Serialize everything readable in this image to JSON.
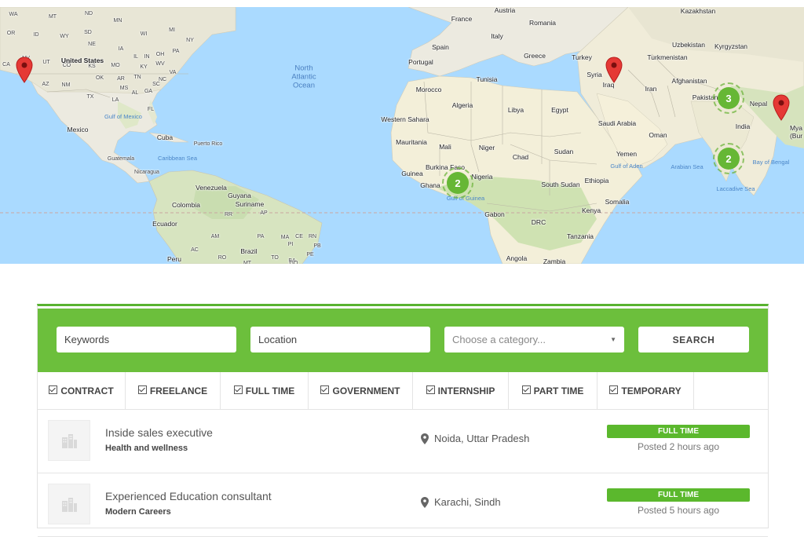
{
  "map": {
    "ocean_labels": [
      {
        "text": "North\nAtlantic\nOcean"
      }
    ],
    "land_labels": [
      "WA",
      "MT",
      "ND",
      "MN",
      "WI",
      "MI",
      "OR",
      "ID",
      "WY",
      "SD",
      "IA",
      "NE",
      "IL",
      "IN",
      "OH",
      "PA",
      "NY",
      "NV",
      "UT",
      "CO",
      "KS",
      "MO",
      "KY",
      "WV",
      "VA",
      "CA",
      "AZ",
      "NM",
      "OK",
      "AR",
      "TN",
      "NC",
      "TX",
      "MS",
      "AL",
      "GA",
      "SC",
      "LA",
      "FL",
      "United States",
      "Mexico",
      "Cuba",
      "Puerto Rico",
      "Guatemala",
      "Nicaragua",
      "Venezuela",
      "Guyana",
      "Suriname",
      "Colombia",
      "Ecuador",
      "Peru",
      "Brazil",
      "AM",
      "PA",
      "MA",
      "CE",
      "RN",
      "PB",
      "PI",
      "PE",
      "TO",
      "BA",
      "AC",
      "RO",
      "MT",
      "AP",
      "RR",
      "GO",
      "France",
      "Austria",
      "Romania",
      "Spain",
      "Italy",
      "Portugal",
      "Greece",
      "Turkey",
      "Syria",
      "Iraq",
      "Iran",
      "Tunisia",
      "Morocco",
      "Algeria",
      "Libya",
      "Egypt",
      "Western Sahara",
      "Mauritania",
      "Mali",
      "Niger",
      "Chad",
      "Sudan",
      "Burkina Faso",
      "Ghana",
      "Guinea",
      "Nigeria",
      "South Sudan",
      "Ethiopia",
      "Somalia",
      "Kenya",
      "Gabon",
      "DRC",
      "Tanzania",
      "Angola",
      "Zambia",
      "Saudi Arabia",
      "Oman",
      "Yemen",
      "Afghanistan",
      "Pakistan",
      "India",
      "Nepal",
      "Kazakhstan",
      "Uzbekistan",
      "Kyrgyzstan",
      "Turkmenistan",
      "Mya",
      "(Bur"
    ],
    "sea_labels": [
      "Gulf of Mexico",
      "Caribbean Sea",
      "Gulf of Guinea",
      "Gulf of Aden",
      "Arabian Sea",
      "Bay of Bengal",
      "Laccadive Sea"
    ],
    "clusters": [
      {
        "count": "2"
      },
      {
        "count": "3"
      },
      {
        "count": "2"
      }
    ],
    "pin_color": "#e53935",
    "cluster_color": "#66b735"
  },
  "search": {
    "keywords_placeholder": "Keywords",
    "location_placeholder": "Location",
    "category_placeholder": "Choose a category...",
    "button_label": "SEARCH",
    "accent_color": "#6cbf3c"
  },
  "filters": [
    {
      "label": "CONTRACT",
      "checked": true
    },
    {
      "label": "FREELANCE",
      "checked": true
    },
    {
      "label": "FULL TIME",
      "checked": true
    },
    {
      "label": "GOVERNMENT",
      "checked": true
    },
    {
      "label": "INTERNSHIP",
      "checked": true
    },
    {
      "label": "PART TIME",
      "checked": true
    },
    {
      "label": "TEMPORARY",
      "checked": true
    }
  ],
  "jobs": [
    {
      "title": "Inside sales executive",
      "company": "Health and wellness",
      "location": "Noida, Uttar Pradesh",
      "type": "FULL TIME",
      "posted": "Posted 2 hours ago"
    },
    {
      "title": "Experienced Education consultant",
      "company": "Modern Careers",
      "location": "Karachi, Sindh",
      "type": "FULL TIME",
      "posted": "Posted 5 hours ago"
    }
  ]
}
